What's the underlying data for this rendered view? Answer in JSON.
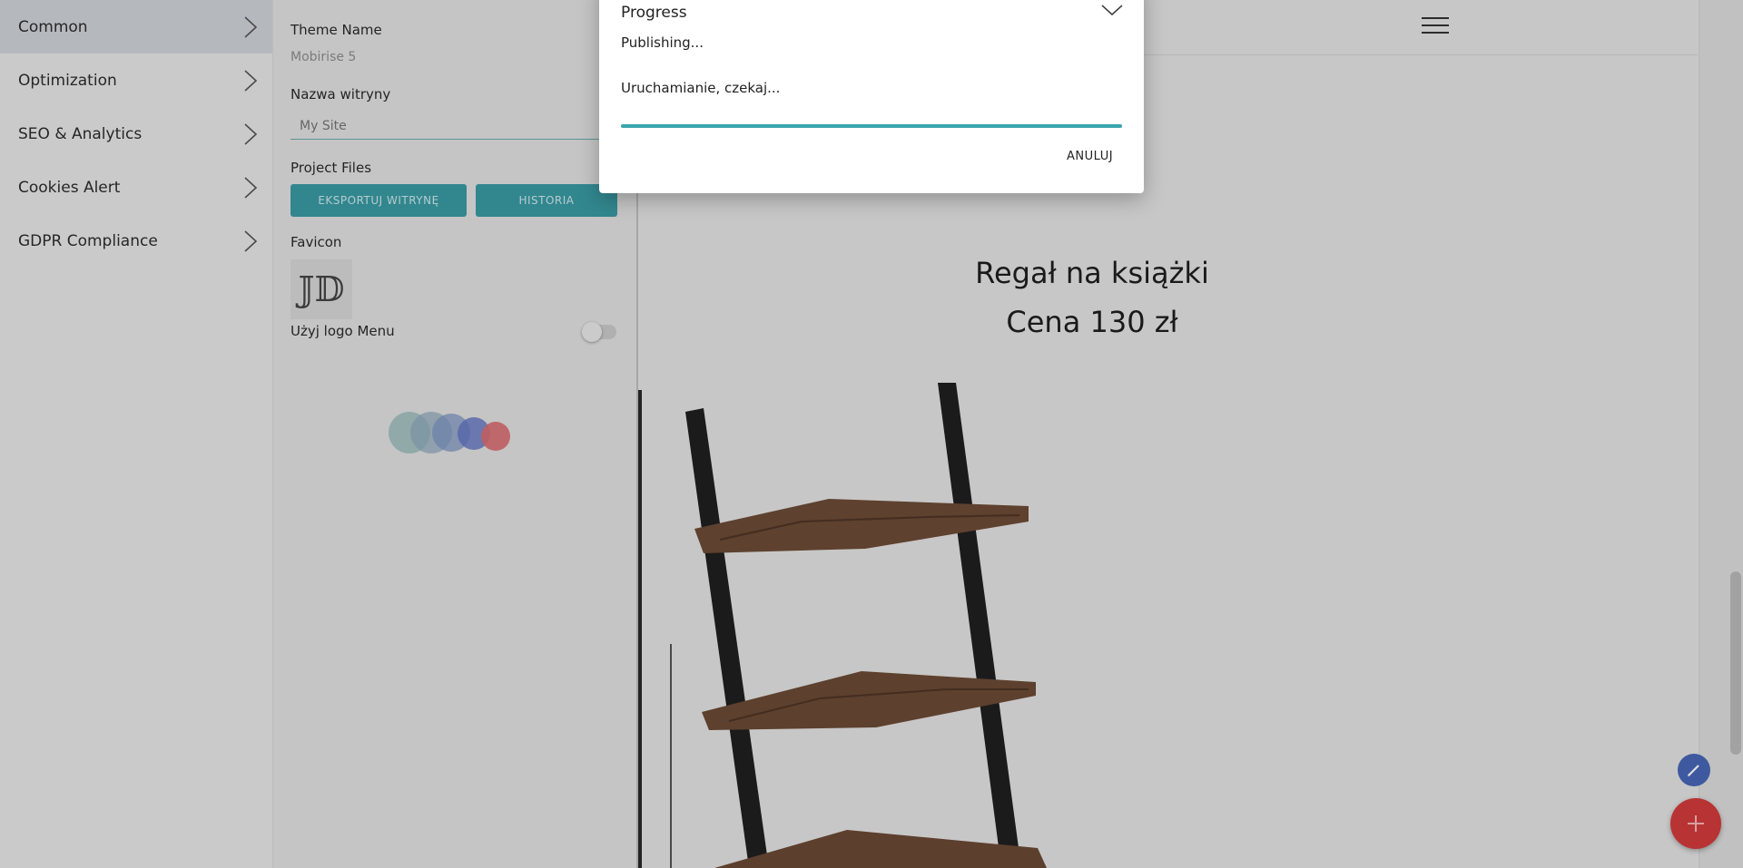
{
  "sidebar": {
    "items": [
      {
        "label": "Common",
        "active": true
      },
      {
        "label": "Optimization",
        "active": false
      },
      {
        "label": "SEO & Analytics",
        "active": false
      },
      {
        "label": "Cookies Alert",
        "active": false
      },
      {
        "label": "GDPR Compliance",
        "active": false
      }
    ]
  },
  "settings": {
    "theme_name_label": "Theme Name",
    "theme_name_value": "Mobirise 5",
    "site_name_label": "Nazwa witryny",
    "site_name_placeholder": "My Site",
    "project_files_label": "Project Files",
    "export_button": "EKSPORTUJ WITRYNĘ",
    "history_button": "HISTORIA",
    "favicon_label": "Favicon",
    "use_logo_label": "Użyj logo Menu",
    "use_logo_enabled": false
  },
  "preview": {
    "product_name": "Regał na książki",
    "product_price": "Cena 130 zł"
  },
  "dialog": {
    "title": "Progress",
    "status": "Publishing...",
    "substatus": "Uruchamianie, czekaj...",
    "cancel_label": "ANULUJ",
    "progress": 1.0
  },
  "colors": {
    "accent": "#3a9aa3",
    "fab_add": "#d23b3b",
    "fab_edit": "#4766b5"
  },
  "icons": {
    "close": "close-icon",
    "chevron": "chevron-right-icon",
    "menu": "hamburger-menu-icon",
    "edit": "pencil-icon",
    "add": "plus-icon"
  }
}
